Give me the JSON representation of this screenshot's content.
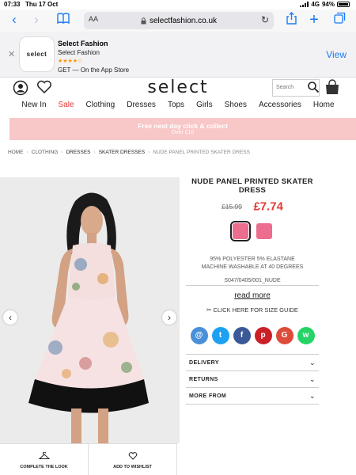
{
  "status_bar": {
    "time": "07:33",
    "date": "Thu 17 Oct",
    "network": "4G",
    "battery": "94%"
  },
  "browser": {
    "url": "selectfashion.co.uk",
    "text_size": "AA"
  },
  "app_banner": {
    "close": "✕",
    "icon_text": "select",
    "name": "Select Fashion",
    "publisher": "Select Fashion",
    "stars": "★★★★☆",
    "store": "GET — On the App Store",
    "view_label": "View"
  },
  "header": {
    "logo": "select",
    "search_placeholder": "Search",
    "nav": [
      "New In",
      "Sale",
      "Clothing",
      "Dresses",
      "Tops",
      "Girls",
      "Shoes",
      "Accessories",
      "Home"
    ]
  },
  "promo": {
    "line1": "Free next day click & collect",
    "line2": "Over £10"
  },
  "breadcrumb": [
    "HOME",
    "CLOTHING",
    "DRESSES",
    "SKATER DRESSES",
    "NUDE PANEL PRINTED SKATER DRESS"
  ],
  "product": {
    "title": "NUDE PANEL PRINTED SKATER DRESS",
    "old_price": "£15.99",
    "price": "£7.74",
    "swatch_colors": [
      "#ec6d8e",
      "#ec6d8e"
    ],
    "composition": "95% POLYESTER 5% ELASTANE",
    "care": "MACHINE WASHABLE AT 40 DEGREES",
    "sku": "S047/0405/001_NUDE",
    "read_more": "read more",
    "size_guide": "CLICK HERE FOR SIZE GUIDE"
  },
  "share": [
    {
      "icon": "@",
      "color": "#4a90d9"
    },
    {
      "icon": "t",
      "color": "#1da1f2"
    },
    {
      "icon": "f",
      "color": "#3b5998"
    },
    {
      "icon": "p",
      "color": "#cb2027"
    },
    {
      "icon": "G",
      "color": "#dd4b39"
    },
    {
      "icon": "w",
      "color": "#25d366"
    }
  ],
  "accordion": [
    "DELIVERY",
    "RETURNS",
    "MORE FROM"
  ],
  "actions": {
    "complete_look": "COMPLETE THE LOOK",
    "wishlist": "ADD TO WISHLIST"
  },
  "colors": {
    "accent_red": "#e53935",
    "promo_pink": "#f8c7c8",
    "ios_blue": "#1a7af8"
  }
}
